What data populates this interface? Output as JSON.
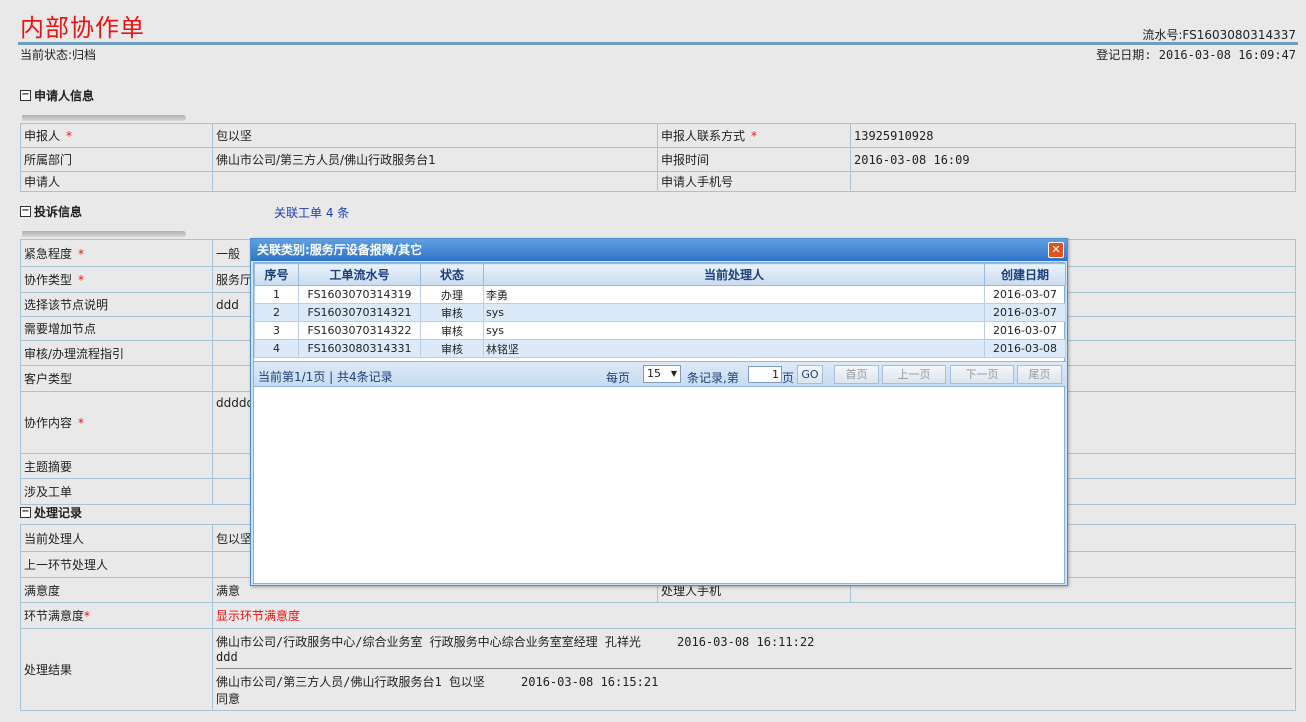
{
  "header": {
    "title": "内部协作单",
    "serial": "流水号:FS1603080314337",
    "status": "当前状态:归档",
    "reg_date": "登记日期: 2016-03-08 16:09:47"
  },
  "sections": {
    "applicant": "申请人信息",
    "complaint": "投诉信息",
    "process": "处理记录",
    "related_link": "关联工单 4 条",
    "toggle": "⊟"
  },
  "applicant": {
    "reporter_label": "申报人",
    "reporter": "包以坚",
    "contact_label": "申报人联系方式",
    "contact": "13925910928",
    "dept_label": "所属部门",
    "dept": "佛山市公司/第三方人员/佛山行政服务台1",
    "time_label": "申报时间",
    "time": "2016-03-08 16:09",
    "applicant_label": "申请人",
    "phone_label": "申请人手机号",
    "req": "*"
  },
  "complaint": {
    "urgency_label": "紧急程度",
    "urgency": "一般",
    "type_label": "协作类型",
    "type": "服务厅",
    "node_label": "选择该节点说明",
    "node": "ddd",
    "addnode_label": "需要增加节点",
    "guide_label": "审核/办理流程指引",
    "cust_label": "客户类型",
    "content_label": "协作内容",
    "content": "ddddd",
    "summary_label": "主题摘要",
    "order_label": "涉及工单"
  },
  "process": {
    "handler_label": "当前处理人",
    "handler": "包以坚",
    "prev_label": "上一环节处理人",
    "satis_label": "满意度",
    "satis": "满意",
    "handler_phone_label": "处理人手机",
    "node_satis_label": "环节满意度",
    "node_satis": "显示环节满意度",
    "result_label": "处理结果",
    "results": [
      {
        "line": "佛山市公司/行政服务中心/综合业务室 行政服务中心综合业务室室经理 孔祥光     2016-03-08 16:11:22",
        "text": "ddd"
      },
      {
        "line": "佛山市公司/第三方人员/佛山行政服务台1 包以坚     2016-03-08 16:15:21",
        "text": "同意"
      }
    ]
  },
  "dialog": {
    "title": "关联类别:服务厅设备报障/其它",
    "close": "✕",
    "columns": [
      "序号",
      "工单流水号",
      "状态",
      "当前处理人",
      "创建日期"
    ],
    "rows": [
      [
        "1",
        "FS1603070314319",
        "办理",
        "李勇",
        "2016-03-07"
      ],
      [
        "2",
        "FS1603070314321",
        "审核",
        "sys",
        "2016-03-07"
      ],
      [
        "3",
        "FS1603070314322",
        "审核",
        "sys",
        "2016-03-07"
      ],
      [
        "4",
        "FS1603080314331",
        "审核",
        "林铭坚",
        "2016-03-08"
      ]
    ],
    "pager": {
      "info": "当前第1/1页 | 共4条记录",
      "per_page": "每页",
      "page_size": "15",
      "records": "条记录,第",
      "page": "1",
      "page_unit": "页",
      "go": "GO",
      "first": "首页",
      "prev": "上一页",
      "next": "下一页",
      "last": "尾页",
      "arrow": "▼"
    }
  }
}
